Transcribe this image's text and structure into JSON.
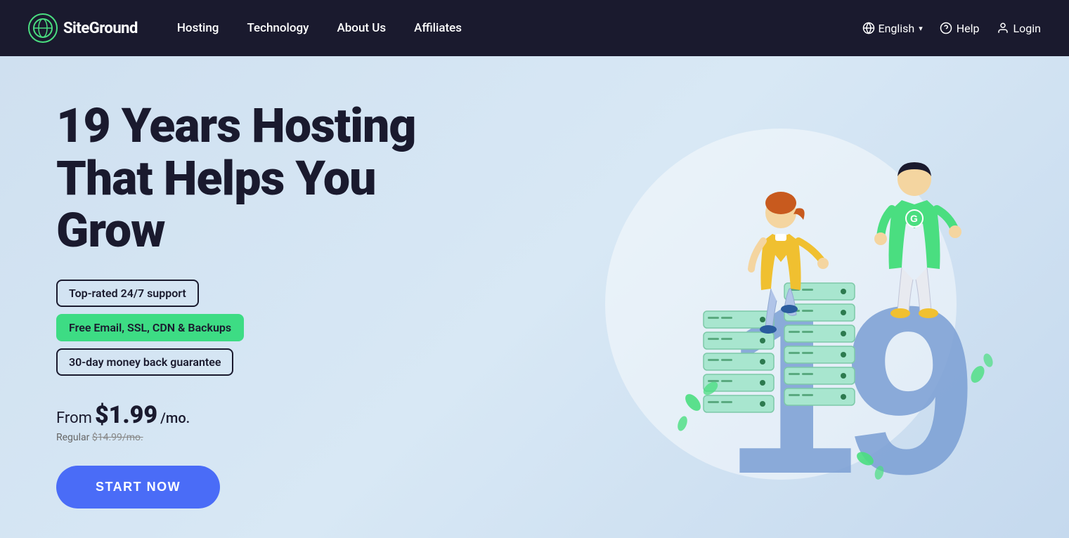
{
  "brand": {
    "name": "SiteGround",
    "logo_alt": "SiteGround Logo"
  },
  "nav": {
    "links": [
      {
        "id": "hosting",
        "label": "Hosting"
      },
      {
        "id": "technology",
        "label": "Technology"
      },
      {
        "id": "about-us",
        "label": "About Us"
      },
      {
        "id": "affiliates",
        "label": "Affiliates"
      }
    ],
    "right": {
      "language": "English",
      "help": "Help",
      "login": "Login"
    }
  },
  "hero": {
    "title_line1": "19 Years Hosting",
    "title_line2": "That Helps You Grow",
    "features": [
      {
        "id": "support",
        "text": "Top-rated 24/7 support",
        "style": "outline"
      },
      {
        "id": "free",
        "text": "Free Email, SSL, CDN & Backups",
        "style": "green"
      },
      {
        "id": "guarantee",
        "text": "30-day money back guarantee",
        "style": "outline"
      }
    ],
    "price_from": "From",
    "price_amount": "$1.99",
    "price_period": "/mo.",
    "price_regular_label": "Regular",
    "price_regular": "$14.99/mo.",
    "cta_button": "START NOW"
  },
  "colors": {
    "bg": "#cfe0f0",
    "nav_bg": "#1a1a2e",
    "accent_blue": "#4a6cf7",
    "accent_green": "#3ddc84",
    "text_dark": "#1a1a2e"
  }
}
